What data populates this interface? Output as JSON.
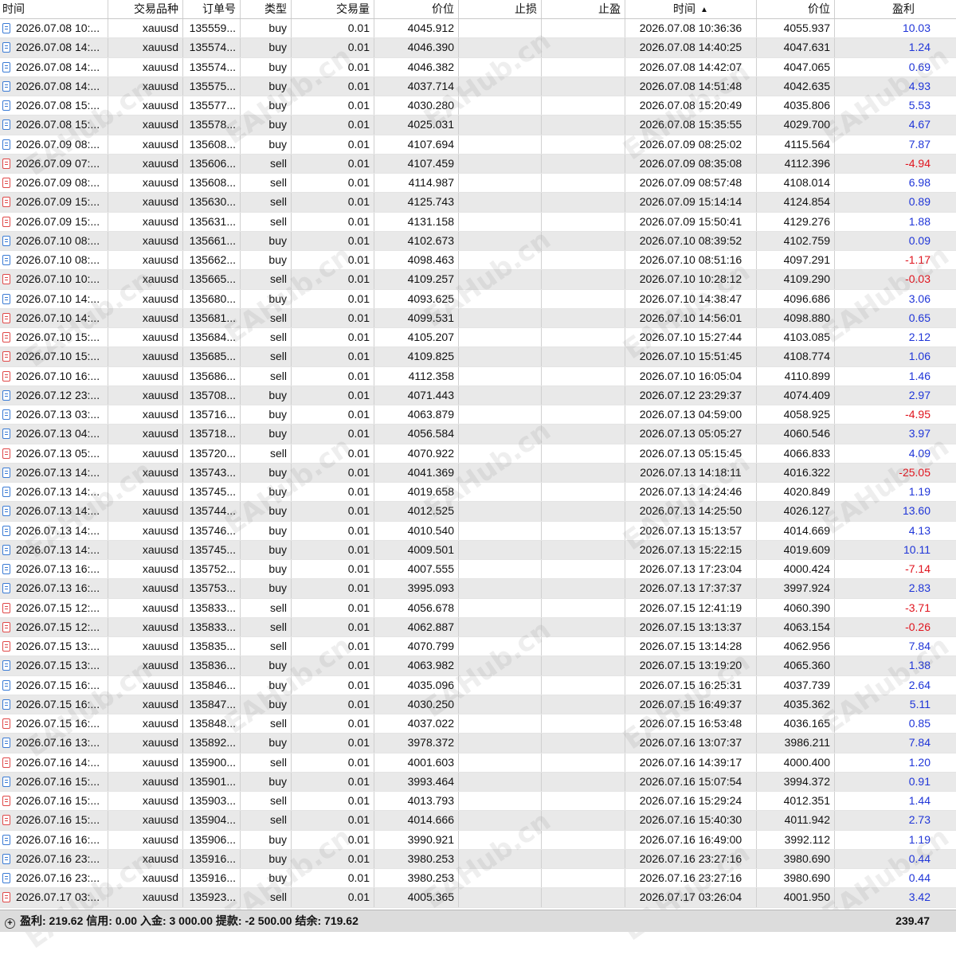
{
  "columns": {
    "open_time": "时间",
    "symbol": "交易品种",
    "ticket": "订单号",
    "type": "类型",
    "volume": "交易量",
    "open_price": "价位",
    "sl": "止损",
    "tp": "止盈",
    "close_time": "时间",
    "close_price": "价位",
    "profit": "盈利",
    "sort_indicator": "▲"
  },
  "rows": [
    {
      "open_time": "2026.07.08 10:...",
      "symbol": "xauusd",
      "ticket": "135559...",
      "type": "buy",
      "volume": "0.01",
      "open_price": "4045.912",
      "sl": "",
      "tp": "",
      "close_time": "2026.07.08 10:36:36",
      "close_price": "4055.937",
      "profit": "10.03"
    },
    {
      "open_time": "2026.07.08 14:...",
      "symbol": "xauusd",
      "ticket": "135574...",
      "type": "buy",
      "volume": "0.01",
      "open_price": "4046.390",
      "sl": "",
      "tp": "",
      "close_time": "2026.07.08 14:40:25",
      "close_price": "4047.631",
      "profit": "1.24"
    },
    {
      "open_time": "2026.07.08 14:...",
      "symbol": "xauusd",
      "ticket": "135574...",
      "type": "buy",
      "volume": "0.01",
      "open_price": "4046.382",
      "sl": "",
      "tp": "",
      "close_time": "2026.07.08 14:42:07",
      "close_price": "4047.065",
      "profit": "0.69"
    },
    {
      "open_time": "2026.07.08 14:...",
      "symbol": "xauusd",
      "ticket": "135575...",
      "type": "buy",
      "volume": "0.01",
      "open_price": "4037.714",
      "sl": "",
      "tp": "",
      "close_time": "2026.07.08 14:51:48",
      "close_price": "4042.635",
      "profit": "4.93"
    },
    {
      "open_time": "2026.07.08 15:...",
      "symbol": "xauusd",
      "ticket": "135577...",
      "type": "buy",
      "volume": "0.01",
      "open_price": "4030.280",
      "sl": "",
      "tp": "",
      "close_time": "2026.07.08 15:20:49",
      "close_price": "4035.806",
      "profit": "5.53"
    },
    {
      "open_time": "2026.07.08 15:...",
      "symbol": "xauusd",
      "ticket": "135578...",
      "type": "buy",
      "volume": "0.01",
      "open_price": "4025.031",
      "sl": "",
      "tp": "",
      "close_time": "2026.07.08 15:35:55",
      "close_price": "4029.700",
      "profit": "4.67"
    },
    {
      "open_time": "2026.07.09 08:...",
      "symbol": "xauusd",
      "ticket": "135608...",
      "type": "buy",
      "volume": "0.01",
      "open_price": "4107.694",
      "sl": "",
      "tp": "",
      "close_time": "2026.07.09 08:25:02",
      "close_price": "4115.564",
      "profit": "7.87"
    },
    {
      "open_time": "2026.07.09 07:...",
      "symbol": "xauusd",
      "ticket": "135606...",
      "type": "sell",
      "volume": "0.01",
      "open_price": "4107.459",
      "sl": "",
      "tp": "",
      "close_time": "2026.07.09 08:35:08",
      "close_price": "4112.396",
      "profit": "-4.94"
    },
    {
      "open_time": "2026.07.09 08:...",
      "symbol": "xauusd",
      "ticket": "135608...",
      "type": "sell",
      "volume": "0.01",
      "open_price": "4114.987",
      "sl": "",
      "tp": "",
      "close_time": "2026.07.09 08:57:48",
      "close_price": "4108.014",
      "profit": "6.98"
    },
    {
      "open_time": "2026.07.09 15:...",
      "symbol": "xauusd",
      "ticket": "135630...",
      "type": "sell",
      "volume": "0.01",
      "open_price": "4125.743",
      "sl": "",
      "tp": "",
      "close_time": "2026.07.09 15:14:14",
      "close_price": "4124.854",
      "profit": "0.89"
    },
    {
      "open_time": "2026.07.09 15:...",
      "symbol": "xauusd",
      "ticket": "135631...",
      "type": "sell",
      "volume": "0.01",
      "open_price": "4131.158",
      "sl": "",
      "tp": "",
      "close_time": "2026.07.09 15:50:41",
      "close_price": "4129.276",
      "profit": "1.88"
    },
    {
      "open_time": "2026.07.10 08:...",
      "symbol": "xauusd",
      "ticket": "135661...",
      "type": "buy",
      "volume": "0.01",
      "open_price": "4102.673",
      "sl": "",
      "tp": "",
      "close_time": "2026.07.10 08:39:52",
      "close_price": "4102.759",
      "profit": "0.09"
    },
    {
      "open_time": "2026.07.10 08:...",
      "symbol": "xauusd",
      "ticket": "135662...",
      "type": "buy",
      "volume": "0.01",
      "open_price": "4098.463",
      "sl": "",
      "tp": "",
      "close_time": "2026.07.10 08:51:16",
      "close_price": "4097.291",
      "profit": "-1.17"
    },
    {
      "open_time": "2026.07.10 10:...",
      "symbol": "xauusd",
      "ticket": "135665...",
      "type": "sell",
      "volume": "0.01",
      "open_price": "4109.257",
      "sl": "",
      "tp": "",
      "close_time": "2026.07.10 10:28:12",
      "close_price": "4109.290",
      "profit": "-0.03"
    },
    {
      "open_time": "2026.07.10 14:...",
      "symbol": "xauusd",
      "ticket": "135680...",
      "type": "buy",
      "volume": "0.01",
      "open_price": "4093.625",
      "sl": "",
      "tp": "",
      "close_time": "2026.07.10 14:38:47",
      "close_price": "4096.686",
      "profit": "3.06"
    },
    {
      "open_time": "2026.07.10 14:...",
      "symbol": "xauusd",
      "ticket": "135681...",
      "type": "sell",
      "volume": "0.01",
      "open_price": "4099.531",
      "sl": "",
      "tp": "",
      "close_time": "2026.07.10 14:56:01",
      "close_price": "4098.880",
      "profit": "0.65"
    },
    {
      "open_time": "2026.07.10 15:...",
      "symbol": "xauusd",
      "ticket": "135684...",
      "type": "sell",
      "volume": "0.01",
      "open_price": "4105.207",
      "sl": "",
      "tp": "",
      "close_time": "2026.07.10 15:27:44",
      "close_price": "4103.085",
      "profit": "2.12"
    },
    {
      "open_time": "2026.07.10 15:...",
      "symbol": "xauusd",
      "ticket": "135685...",
      "type": "sell",
      "volume": "0.01",
      "open_price": "4109.825",
      "sl": "",
      "tp": "",
      "close_time": "2026.07.10 15:51:45",
      "close_price": "4108.774",
      "profit": "1.06"
    },
    {
      "open_time": "2026.07.10 16:...",
      "symbol": "xauusd",
      "ticket": "135686...",
      "type": "sell",
      "volume": "0.01",
      "open_price": "4112.358",
      "sl": "",
      "tp": "",
      "close_time": "2026.07.10 16:05:04",
      "close_price": "4110.899",
      "profit": "1.46"
    },
    {
      "open_time": "2026.07.12 23:...",
      "symbol": "xauusd",
      "ticket": "135708...",
      "type": "buy",
      "volume": "0.01",
      "open_price": "4071.443",
      "sl": "",
      "tp": "",
      "close_time": "2026.07.12 23:29:37",
      "close_price": "4074.409",
      "profit": "2.97"
    },
    {
      "open_time": "2026.07.13 03:...",
      "symbol": "xauusd",
      "ticket": "135716...",
      "type": "buy",
      "volume": "0.01",
      "open_price": "4063.879",
      "sl": "",
      "tp": "",
      "close_time": "2026.07.13 04:59:00",
      "close_price": "4058.925",
      "profit": "-4.95"
    },
    {
      "open_time": "2026.07.13 04:...",
      "symbol": "xauusd",
      "ticket": "135718...",
      "type": "buy",
      "volume": "0.01",
      "open_price": "4056.584",
      "sl": "",
      "tp": "",
      "close_time": "2026.07.13 05:05:27",
      "close_price": "4060.546",
      "profit": "3.97"
    },
    {
      "open_time": "2026.07.13 05:...",
      "symbol": "xauusd",
      "ticket": "135720...",
      "type": "sell",
      "volume": "0.01",
      "open_price": "4070.922",
      "sl": "",
      "tp": "",
      "close_time": "2026.07.13 05:15:45",
      "close_price": "4066.833",
      "profit": "4.09"
    },
    {
      "open_time": "2026.07.13 14:...",
      "symbol": "xauusd",
      "ticket": "135743...",
      "type": "buy",
      "volume": "0.01",
      "open_price": "4041.369",
      "sl": "",
      "tp": "",
      "close_time": "2026.07.13 14:18:11",
      "close_price": "4016.322",
      "profit": "-25.05"
    },
    {
      "open_time": "2026.07.13 14:...",
      "symbol": "xauusd",
      "ticket": "135745...",
      "type": "buy",
      "volume": "0.01",
      "open_price": "4019.658",
      "sl": "",
      "tp": "",
      "close_time": "2026.07.13 14:24:46",
      "close_price": "4020.849",
      "profit": "1.19"
    },
    {
      "open_time": "2026.07.13 14:...",
      "symbol": "xauusd",
      "ticket": "135744...",
      "type": "buy",
      "volume": "0.01",
      "open_price": "4012.525",
      "sl": "",
      "tp": "",
      "close_time": "2026.07.13 14:25:50",
      "close_price": "4026.127",
      "profit": "13.60"
    },
    {
      "open_time": "2026.07.13 14:...",
      "symbol": "xauusd",
      "ticket": "135746...",
      "type": "buy",
      "volume": "0.01",
      "open_price": "4010.540",
      "sl": "",
      "tp": "",
      "close_time": "2026.07.13 15:13:57",
      "close_price": "4014.669",
      "profit": "4.13"
    },
    {
      "open_time": "2026.07.13 14:...",
      "symbol": "xauusd",
      "ticket": "135745...",
      "type": "buy",
      "volume": "0.01",
      "open_price": "4009.501",
      "sl": "",
      "tp": "",
      "close_time": "2026.07.13 15:22:15",
      "close_price": "4019.609",
      "profit": "10.11"
    },
    {
      "open_time": "2026.07.13 16:...",
      "symbol": "xauusd",
      "ticket": "135752...",
      "type": "buy",
      "volume": "0.01",
      "open_price": "4007.555",
      "sl": "",
      "tp": "",
      "close_time": "2026.07.13 17:23:04",
      "close_price": "4000.424",
      "profit": "-7.14"
    },
    {
      "open_time": "2026.07.13 16:...",
      "symbol": "xauusd",
      "ticket": "135753...",
      "type": "buy",
      "volume": "0.01",
      "open_price": "3995.093",
      "sl": "",
      "tp": "",
      "close_time": "2026.07.13 17:37:37",
      "close_price": "3997.924",
      "profit": "2.83"
    },
    {
      "open_time": "2026.07.15 12:...",
      "symbol": "xauusd",
      "ticket": "135833...",
      "type": "sell",
      "volume": "0.01",
      "open_price": "4056.678",
      "sl": "",
      "tp": "",
      "close_time": "2026.07.15 12:41:19",
      "close_price": "4060.390",
      "profit": "-3.71"
    },
    {
      "open_time": "2026.07.15 12:...",
      "symbol": "xauusd",
      "ticket": "135833...",
      "type": "sell",
      "volume": "0.01",
      "open_price": "4062.887",
      "sl": "",
      "tp": "",
      "close_time": "2026.07.15 13:13:37",
      "close_price": "4063.154",
      "profit": "-0.26"
    },
    {
      "open_time": "2026.07.15 13:...",
      "symbol": "xauusd",
      "ticket": "135835...",
      "type": "sell",
      "volume": "0.01",
      "open_price": "4070.799",
      "sl": "",
      "tp": "",
      "close_time": "2026.07.15 13:14:28",
      "close_price": "4062.956",
      "profit": "7.84"
    },
    {
      "open_time": "2026.07.15 13:...",
      "symbol": "xauusd",
      "ticket": "135836...",
      "type": "buy",
      "volume": "0.01",
      "open_price": "4063.982",
      "sl": "",
      "tp": "",
      "close_time": "2026.07.15 13:19:20",
      "close_price": "4065.360",
      "profit": "1.38"
    },
    {
      "open_time": "2026.07.15 16:...",
      "symbol": "xauusd",
      "ticket": "135846...",
      "type": "buy",
      "volume": "0.01",
      "open_price": "4035.096",
      "sl": "",
      "tp": "",
      "close_time": "2026.07.15 16:25:31",
      "close_price": "4037.739",
      "profit": "2.64"
    },
    {
      "open_time": "2026.07.15 16:...",
      "symbol": "xauusd",
      "ticket": "135847...",
      "type": "buy",
      "volume": "0.01",
      "open_price": "4030.250",
      "sl": "",
      "tp": "",
      "close_time": "2026.07.15 16:49:37",
      "close_price": "4035.362",
      "profit": "5.11"
    },
    {
      "open_time": "2026.07.15 16:...",
      "symbol": "xauusd",
      "ticket": "135848...",
      "type": "sell",
      "volume": "0.01",
      "open_price": "4037.022",
      "sl": "",
      "tp": "",
      "close_time": "2026.07.15 16:53:48",
      "close_price": "4036.165",
      "profit": "0.85"
    },
    {
      "open_time": "2026.07.16 13:...",
      "symbol": "xauusd",
      "ticket": "135892...",
      "type": "buy",
      "volume": "0.01",
      "open_price": "3978.372",
      "sl": "",
      "tp": "",
      "close_time": "2026.07.16 13:07:37",
      "close_price": "3986.211",
      "profit": "7.84"
    },
    {
      "open_time": "2026.07.16 14:...",
      "symbol": "xauusd",
      "ticket": "135900...",
      "type": "sell",
      "volume": "0.01",
      "open_price": "4001.603",
      "sl": "",
      "tp": "",
      "close_time": "2026.07.16 14:39:17",
      "close_price": "4000.400",
      "profit": "1.20"
    },
    {
      "open_time": "2026.07.16 15:...",
      "symbol": "xauusd",
      "ticket": "135901...",
      "type": "buy",
      "volume": "0.01",
      "open_price": "3993.464",
      "sl": "",
      "tp": "",
      "close_time": "2026.07.16 15:07:54",
      "close_price": "3994.372",
      "profit": "0.91"
    },
    {
      "open_time": "2026.07.16 15:...",
      "symbol": "xauusd",
      "ticket": "135903...",
      "type": "sell",
      "volume": "0.01",
      "open_price": "4013.793",
      "sl": "",
      "tp": "",
      "close_time": "2026.07.16 15:29:24",
      "close_price": "4012.351",
      "profit": "1.44"
    },
    {
      "open_time": "2026.07.16 15:...",
      "symbol": "xauusd",
      "ticket": "135904...",
      "type": "sell",
      "volume": "0.01",
      "open_price": "4014.666",
      "sl": "",
      "tp": "",
      "close_time": "2026.07.16 15:40:30",
      "close_price": "4011.942",
      "profit": "2.73"
    },
    {
      "open_time": "2026.07.16 16:...",
      "symbol": "xauusd",
      "ticket": "135906...",
      "type": "buy",
      "volume": "0.01",
      "open_price": "3990.921",
      "sl": "",
      "tp": "",
      "close_time": "2026.07.16 16:49:00",
      "close_price": "3992.112",
      "profit": "1.19"
    },
    {
      "open_time": "2026.07.16 23:...",
      "symbol": "xauusd",
      "ticket": "135916...",
      "type": "buy",
      "volume": "0.01",
      "open_price": "3980.253",
      "sl": "",
      "tp": "",
      "close_time": "2026.07.16 23:27:16",
      "close_price": "3980.690",
      "profit": "0.44"
    },
    {
      "open_time": "2026.07.16 23:...",
      "symbol": "xauusd",
      "ticket": "135916...",
      "type": "buy",
      "volume": "0.01",
      "open_price": "3980.253",
      "sl": "",
      "tp": "",
      "close_time": "2026.07.16 23:27:16",
      "close_price": "3980.690",
      "profit": "0.44"
    },
    {
      "open_time": "2026.07.17 03:...",
      "symbol": "xauusd",
      "ticket": "135923...",
      "type": "sell",
      "volume": "0.01",
      "open_price": "4005.365",
      "sl": "",
      "tp": "",
      "close_time": "2026.07.17 03:26:04",
      "close_price": "4001.950",
      "profit": "3.42"
    }
  ],
  "footer": {
    "summary": "盈利: 219.62  信用: 0.00  入金: 3 000.00  提款: -2 500.00  结余: 719.62",
    "total_profit": "239.47",
    "expand_icon": "plus-circle-icon"
  },
  "watermark": "EAHub.cn",
  "colors": {
    "positive": "#1f35d8",
    "negative": "#e0141e",
    "buy_icon": "#3a7bd5",
    "sell_icon": "#e04848",
    "alt_row": "#e9e9e9",
    "footer_bg": "#dcdcdc"
  }
}
